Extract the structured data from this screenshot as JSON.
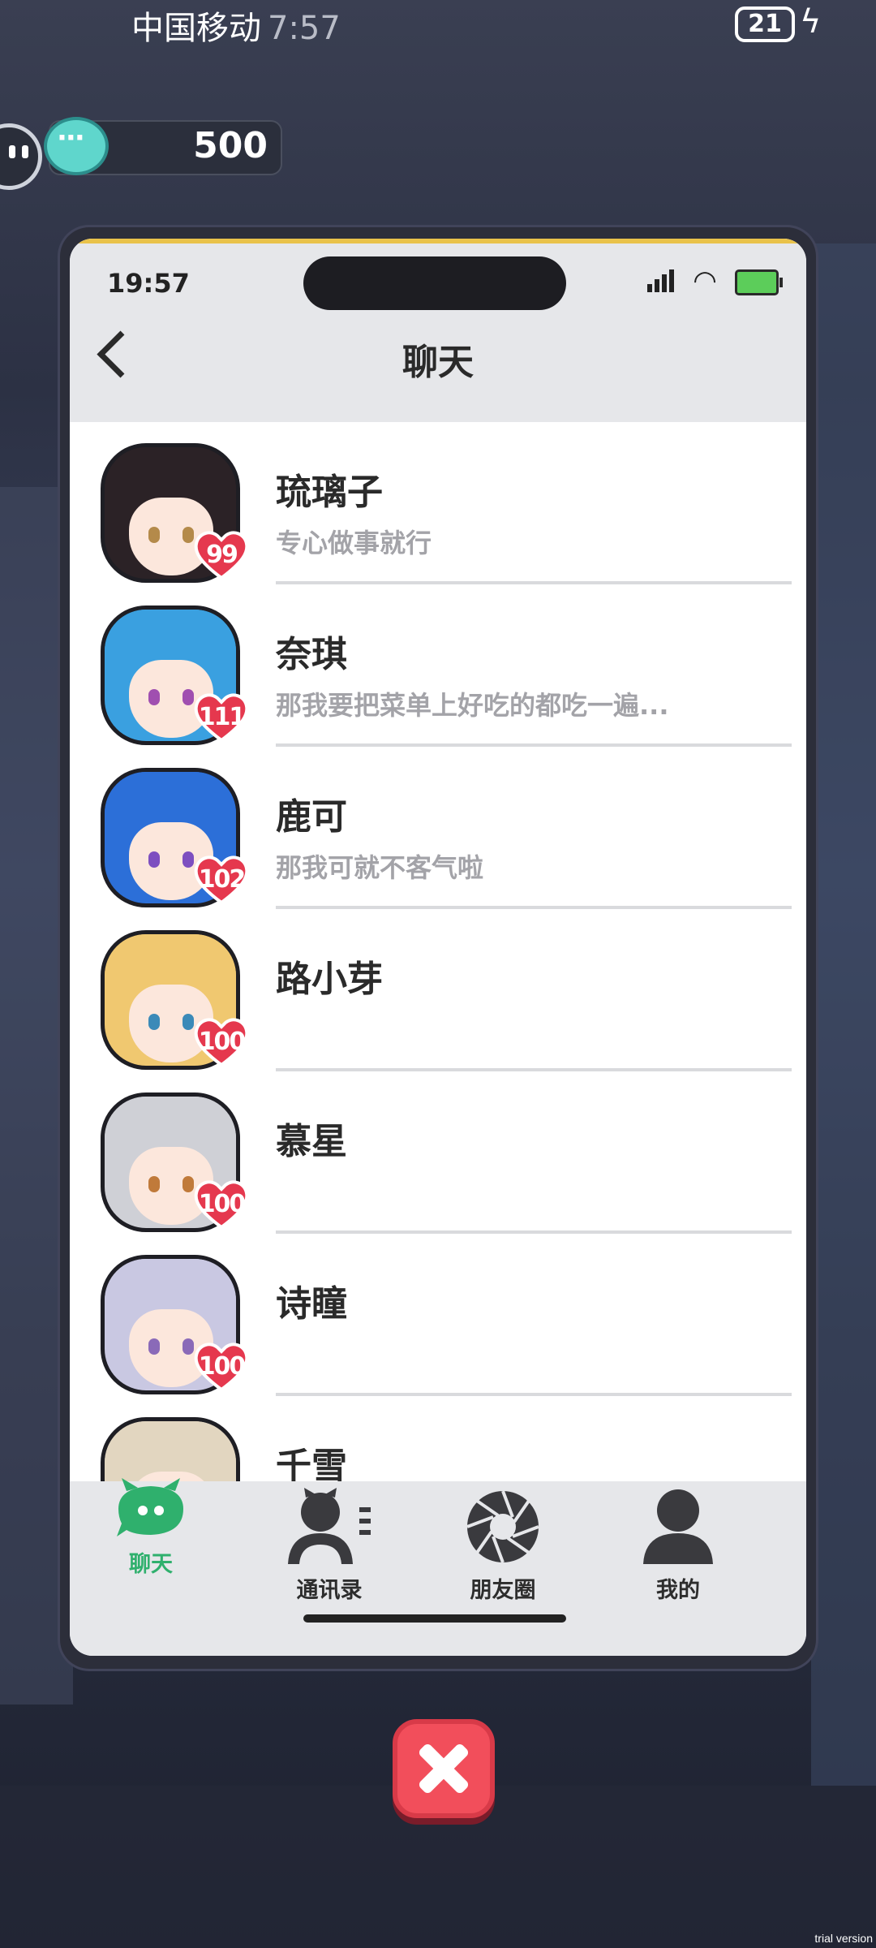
{
  "system_status": {
    "carrier": "中国移动",
    "time": "7:57",
    "battery": "21"
  },
  "currency": {
    "value": "500",
    "icon": "chat-bubble-icon"
  },
  "phone": {
    "status_time": "19:57",
    "title": "聊天"
  },
  "chats": [
    {
      "name": "琉璃子",
      "message": "专心做事就行",
      "affection": "99",
      "hair": "#2b2226",
      "eye": "#b48a4a"
    },
    {
      "name": "奈琪",
      "message": "那我要把菜单上好吃的都吃一遍...",
      "affection": "111",
      "hair": "#3aa0e0",
      "eye": "#a04fb0"
    },
    {
      "name": "鹿可",
      "message": "那我可就不客气啦",
      "affection": "102",
      "hair": "#2c6fd8",
      "eye": "#7d4fc0"
    },
    {
      "name": "路小芽",
      "message": "",
      "affection": "100",
      "hair": "#f0c870",
      "eye": "#3b8ab8"
    },
    {
      "name": "慕星",
      "message": "",
      "affection": "100",
      "hair": "#cfd0d6",
      "eye": "#c07a3a"
    },
    {
      "name": "诗瞳",
      "message": "",
      "affection": "100",
      "hair": "#c9c8e2",
      "eye": "#8a6ab8"
    },
    {
      "name": "千雪",
      "message": "",
      "affection": "",
      "hair": "#e2d6c0",
      "eye": "#8a7a60"
    }
  ],
  "nav": [
    {
      "label": "聊天",
      "icon": "chat-icon",
      "active": true
    },
    {
      "label": "通讯录",
      "icon": "contacts-icon",
      "active": false
    },
    {
      "label": "朋友圈",
      "icon": "moments-icon",
      "active": false
    },
    {
      "label": "我的",
      "icon": "profile-icon",
      "active": false
    }
  ],
  "colors": {
    "accent": "#2fb06d",
    "heart": "#e5384e",
    "close": "#f24e5b"
  },
  "watermark": "trial version"
}
